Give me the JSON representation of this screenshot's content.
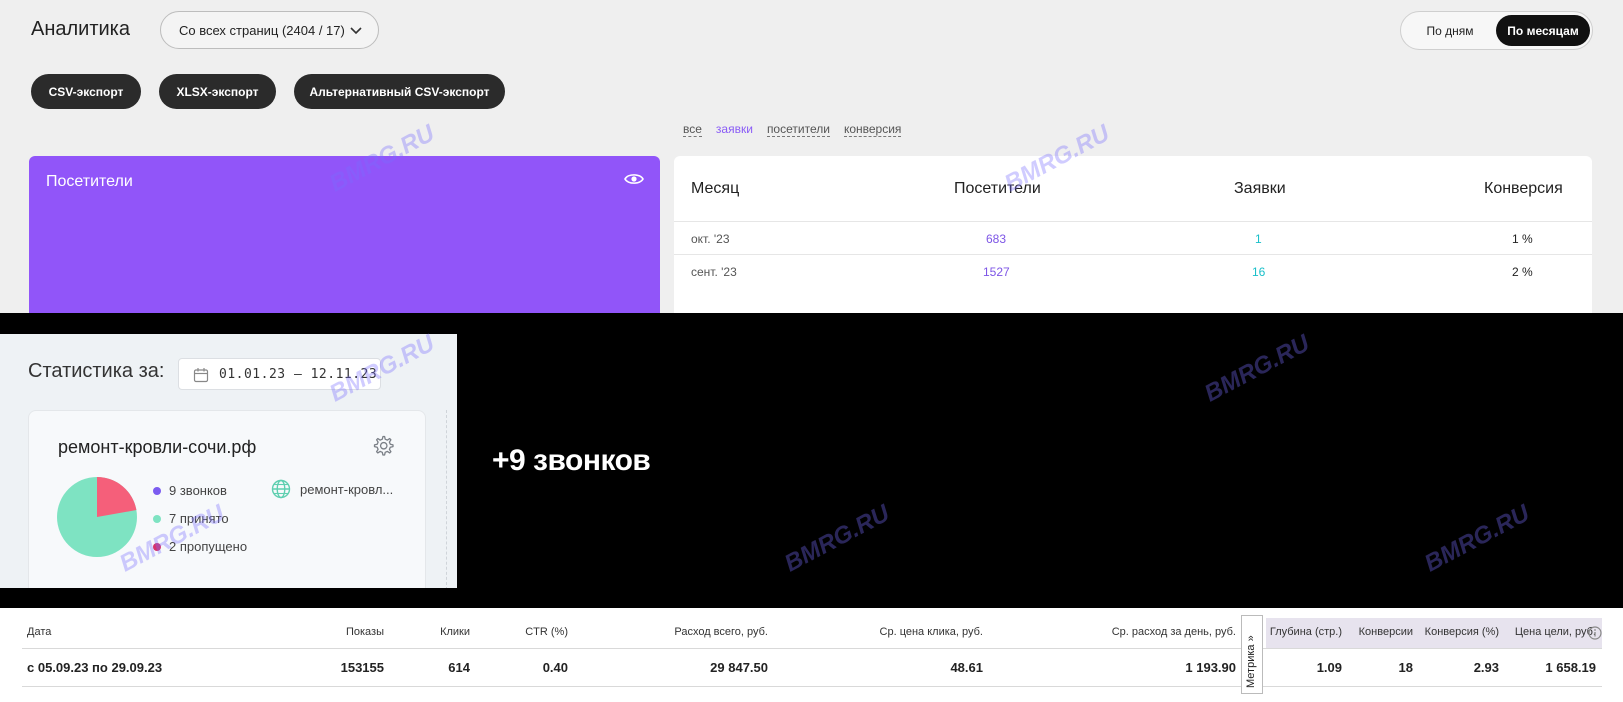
{
  "analytics": {
    "title": "Аналитика",
    "source_select": "Со всех страниц (2404 / 17)",
    "period_toggle": {
      "days": "По дням",
      "months": "По месяцам",
      "selected": "months"
    },
    "export_buttons": [
      "CSV-экспорт",
      "XLSX-экспорт",
      "Альтернативный CSV-экспорт"
    ],
    "filters": [
      {
        "label": "все",
        "active": false
      },
      {
        "label": "заявки",
        "active": true
      },
      {
        "label": "посетители",
        "active": false
      },
      {
        "label": "конверсия",
        "active": false
      }
    ],
    "visitors_card": {
      "title": "Посетители",
      "icon": "eye-icon",
      "color": "#9155f9"
    },
    "table": {
      "headers": [
        "Месяц",
        "Посетители",
        "Заявки",
        "Конверсия"
      ],
      "rows": [
        {
          "month": "окт. '23",
          "visitors": "683",
          "requests": "1",
          "conversion": "1 %"
        },
        {
          "month": "сент. '23",
          "visitors": "1527",
          "requests": "16",
          "conversion": "2 %"
        }
      ]
    }
  },
  "stats": {
    "label": "Статистика за:",
    "date_range": "01.01.23 – 12.11.23",
    "site": {
      "name": "ремонт-кровли-сочи.рф",
      "link": "ремонт-кровл...",
      "legend": [
        {
          "label": "9 звонков",
          "color": "#7b5cf0"
        },
        {
          "label": "7 принято",
          "color": "#7ee3c2"
        },
        {
          "label": "2 пропущено",
          "color": "#d6336c"
        }
      ],
      "pie": {
        "accepted": 7,
        "missed": 2
      },
      "pie_colors": {
        "accepted": "#7ee3c2",
        "missed": "#f55f7a"
      }
    }
  },
  "banner": {
    "text": "+9 звонков"
  },
  "ad_table": {
    "headers": [
      "Дата",
      "Показы",
      "Клики",
      "CTR (%)",
      "Расход всего, руб.",
      "Ср. цена клика, руб.",
      "Ср. расход за день, руб.",
      "Глубина (стр.)",
      "Конверсии",
      "Конверсия (%)",
      "Цена цели, руб."
    ],
    "row": [
      "с 05.09.23 по 29.09.23",
      "153155",
      "614",
      "0.40",
      "29 847.50",
      "48.61",
      "1 193.90",
      "1.09",
      "18",
      "2.93",
      "1 658.19"
    ],
    "metrika_tab": "Метрика »"
  },
  "watermark": "BMRG.RU"
}
